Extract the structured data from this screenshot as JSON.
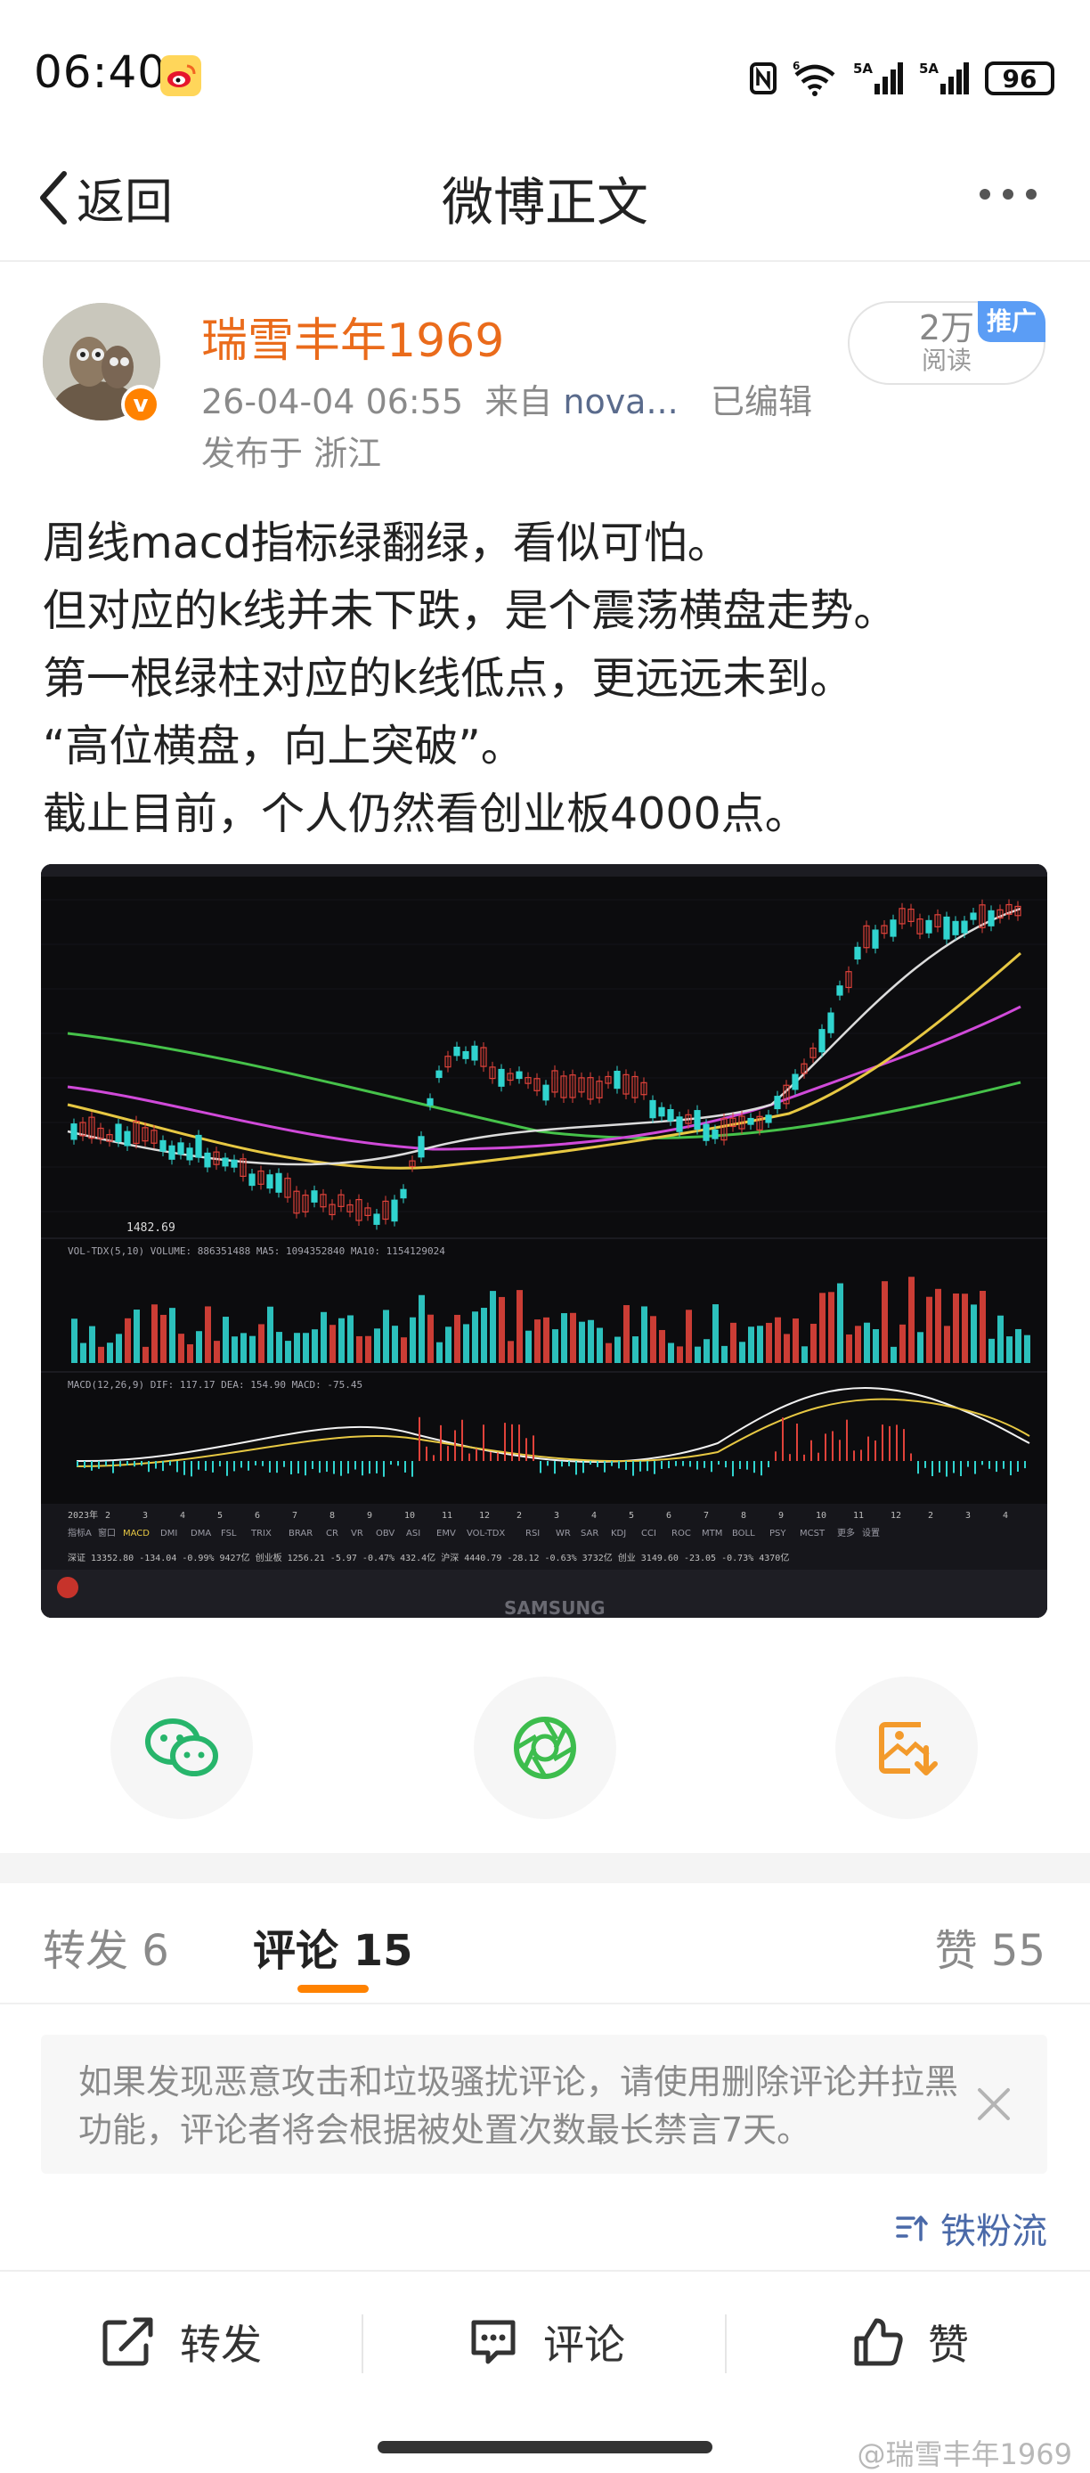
{
  "status_bar": {
    "time": "06:40",
    "battery": "96",
    "app_icon": "weibo-icon"
  },
  "nav": {
    "back_label": "返回",
    "title": "微博正文",
    "more_icon": "more-dots-icon"
  },
  "author": {
    "name": "瑞雪丰年1969",
    "time": "26-04-04 06:55",
    "source_prefix": "来自",
    "source": "nova...",
    "edited": "已编辑",
    "location": "发布于 浙江",
    "reads_count": "2万",
    "reads_label": "阅读",
    "promo_tag": "推广"
  },
  "post": {
    "lines": [
      "周线macd指标绿翻绿，看似可怕。",
      "但对应的k线并未下跌，是个震荡横盘走势。",
      "第一根绿柱对应的k线低点，更远远未到。",
      "“高位横盘，向上突破”。",
      "截止目前，个人仍然看创业板4000点。"
    ]
  },
  "chart_image": {
    "low_label": "1482.69",
    "vol_header": "VOL-TDX(5,10) VOLUME: 886351488 MA5: 1094352840 MA10: 1154129024",
    "macd_header": "MACD(12,26,9) DIF: 117.17 DEA: 154.90 MACD: -75.45",
    "axis_labels": [
      "2023年",
      "2",
      "3",
      "4",
      "5",
      "6",
      "7",
      "8",
      "9",
      "10",
      "11",
      "12",
      "2",
      "3",
      "4",
      "5",
      "6",
      "7",
      "8",
      "9",
      "10",
      "11",
      "12",
      "2",
      "3",
      "4"
    ],
    "indicator_tabs": [
      "指标A",
      "窗口",
      "MACD",
      "DMI",
      "DMA",
      "FSL",
      "TRIX",
      "BRAR",
      "CR",
      "VR",
      "OBV",
      "ASI",
      "EMV",
      "VOL-TDX",
      "RSI",
      "WR",
      "SAR",
      "KDJ",
      "CCI",
      "ROC",
      "MTM",
      "BOLL",
      "PSY",
      "MCST",
      "更多",
      "设置"
    ],
    "quote_row": "深证 13352.80 -134.04 -0.99% 9427亿   创业板 1256.21 -5.97 -0.47% 432.4亿   沪深 4440.79 -28.12 -0.63% 3732亿   创业 3149.60 -23.05 -0.73% 4370亿",
    "monitor_brand": "SAMSUNG"
  },
  "share": {
    "wechat_icon": "wechat-icon",
    "moments_icon": "moments-icon",
    "save_icon": "save-image-icon"
  },
  "tabs": {
    "repost": "转发 6",
    "comment": "评论 15",
    "like": "赞 55"
  },
  "notice": {
    "text": "如果发现恶意攻击和垃圾骚扰评论，请使用删除评论并拉黑功能，评论者将会根据被处置次数最长禁言7天。"
  },
  "sort": {
    "label": "铁粉流"
  },
  "actions": {
    "repost": "转发",
    "comment": "评论",
    "like": "赞"
  },
  "watermark": "@瑞雪丰年1969",
  "colors": {
    "brand_orange": "#ff8200",
    "author_name": "#ea6b1b",
    "link_blue": "#4a69a8",
    "candle_up": "#e0423a",
    "candle_down": "#30d4cf"
  }
}
